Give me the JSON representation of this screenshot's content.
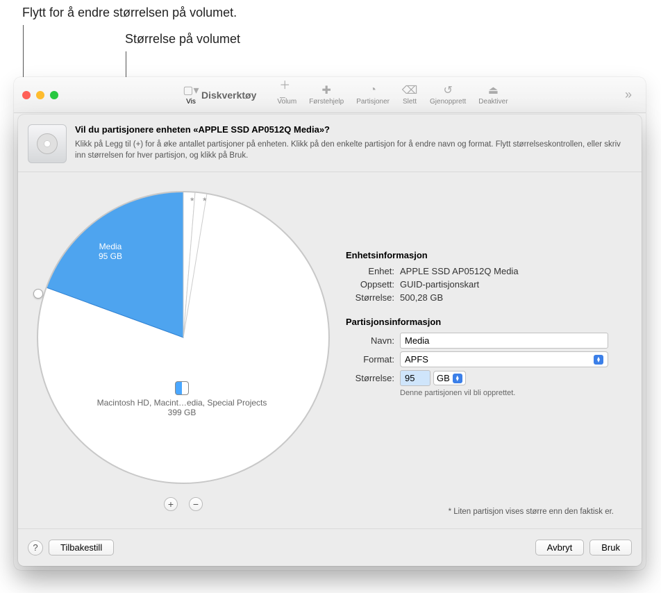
{
  "callouts": {
    "drag": "Flytt for å endre størrelsen på volumet.",
    "size": "Størrelse på volumet"
  },
  "toolbar": {
    "app_title": "Diskverktøy",
    "view": "Vis",
    "volume": "Volum",
    "firstaid": "Førstehjelp",
    "partition": "Partisjoner",
    "erase": "Slett",
    "restore": "Gjenopprett",
    "deactivate": "Deaktiver"
  },
  "sheet": {
    "title": "Vil du partisjonere enheten «APPLE SSD AP0512Q Media»?",
    "subtitle": "Klikk på Legg til (+) for å øke antallet partisjoner på enheten. Klikk på den enkelte partisjon for å endre navn og format. Flytt størrelseskontrollen, eller skriv inn størrelsen for hver partisjon, og klikk på Bruk."
  },
  "chart_data": {
    "type": "pie",
    "title": "",
    "slices": [
      {
        "name": "Media",
        "value_gb": 95,
        "label_lines": [
          "Media",
          "95 GB"
        ],
        "color": "#4ea4ef",
        "selected": true
      },
      {
        "name": "small-1",
        "value_gb": 3,
        "color": "#ffffff",
        "small_marker": "*"
      },
      {
        "name": "small-2",
        "value_gb": 3,
        "color": "#ffffff",
        "small_marker": "*"
      },
      {
        "name": "Macintosh HD, Macint…edia, Special Projects",
        "value_gb": 399,
        "label_lines": [
          "Macintosh HD, Macint…edia, Special Projects",
          "399 GB"
        ],
        "color": "#ffffff"
      }
    ],
    "total_gb": 500.28
  },
  "device_info": {
    "heading": "Enhetsinformasjon",
    "device_label": "Enhet:",
    "device_value": "APPLE SSD AP0512Q Media",
    "layout_label": "Oppsett:",
    "layout_value": "GUID-partisjonskart",
    "size_label": "Størrelse:",
    "size_value": "500,28 GB"
  },
  "partition_info": {
    "heading": "Partisjonsinformasjon",
    "name_label": "Navn:",
    "name_value": "Media",
    "format_label": "Format:",
    "format_value": "APFS",
    "size_label": "Størrelse:",
    "size_value": "95",
    "unit": "GB",
    "hint": "Denne partisjonen vil bli opprettet."
  },
  "footnote": "* Liten partisjon vises større enn den faktisk er.",
  "buttons": {
    "add": "+",
    "remove": "−",
    "reset": "Tilbakestill",
    "cancel": "Avbryt",
    "apply": "Bruk",
    "help": "?"
  }
}
